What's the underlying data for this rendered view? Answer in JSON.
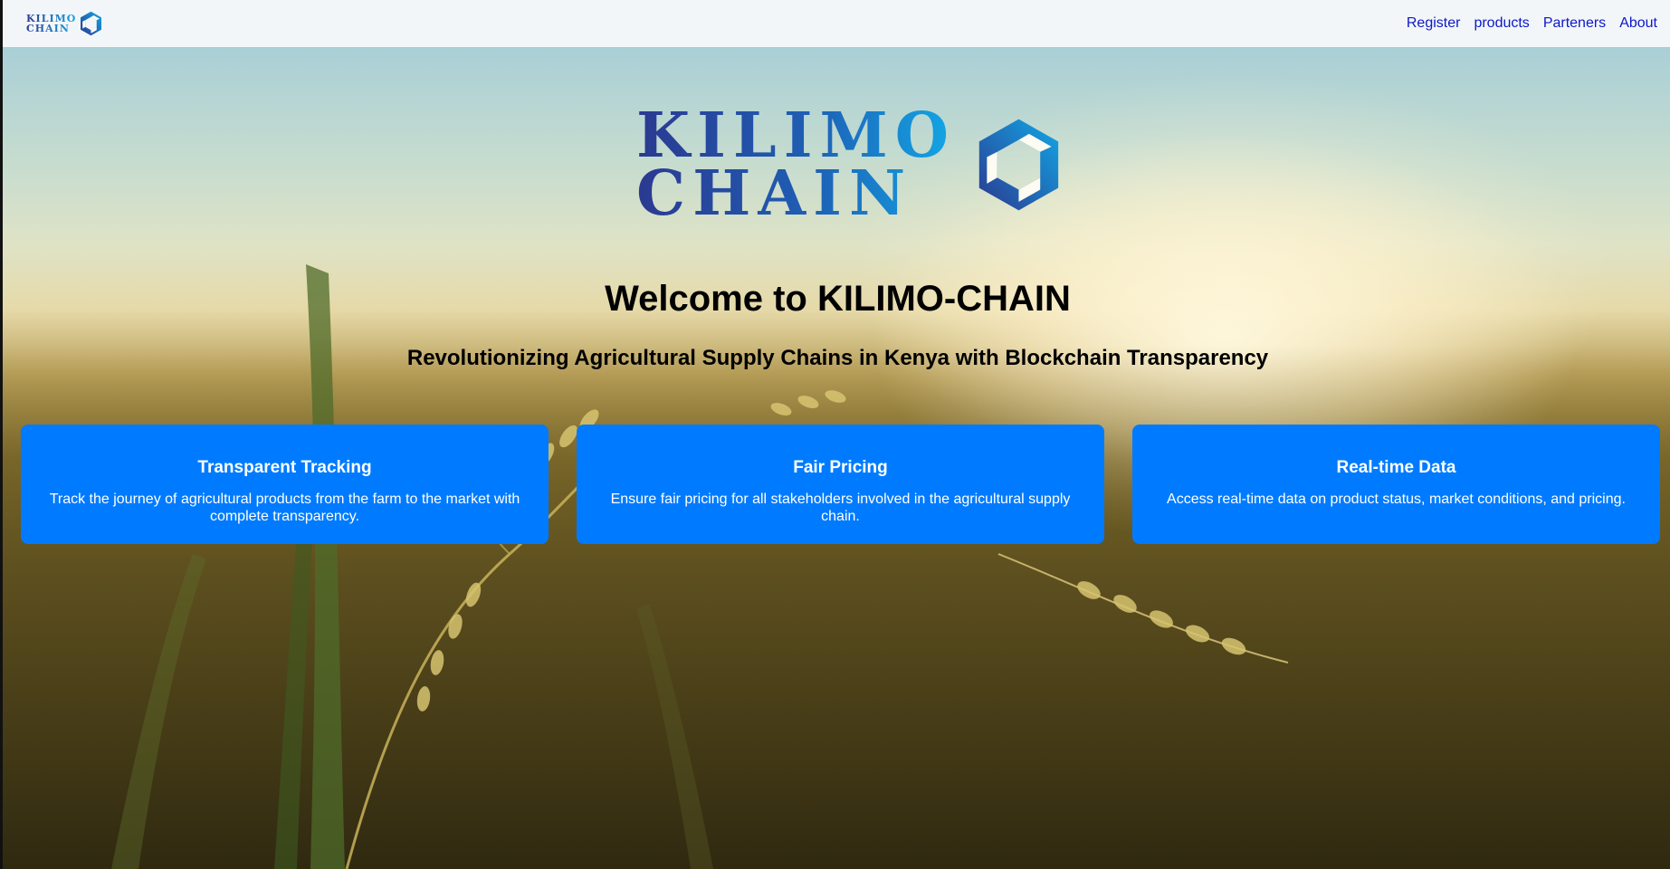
{
  "navbar": {
    "logo": {
      "line1": "KILIMO",
      "line2": "CHAIN"
    },
    "links": [
      {
        "label": "Register"
      },
      {
        "label": "products"
      },
      {
        "label": "Parteners"
      },
      {
        "label": "About"
      }
    ]
  },
  "hero": {
    "logo": {
      "line1": "KILIMO",
      "line2": "CHAIN"
    },
    "title": "Welcome to KILIMO-CHAIN",
    "tagline": "Revolutionizing Agricultural Supply Chains in Kenya with Blockchain Transparency"
  },
  "features": [
    {
      "title": "Transparent Tracking",
      "description": "Track the journey of agricultural products from the farm to the market with complete transparency."
    },
    {
      "title": "Fair Pricing",
      "description": "Ensure fair pricing for all stakeholders involved in the agricultural supply chain."
    },
    {
      "title": "Real-time Data",
      "description": "Access real-time data on product status, market conditions, and pricing."
    }
  ],
  "colors": {
    "navbar_bg": "#f3f6f9",
    "link": "#0b19c8",
    "card_bg": "#007bff",
    "brand_dark": "#2b3990",
    "brand_light": "#12a8e6"
  },
  "icons": [
    "kilimo-chain-logo-icon"
  ]
}
